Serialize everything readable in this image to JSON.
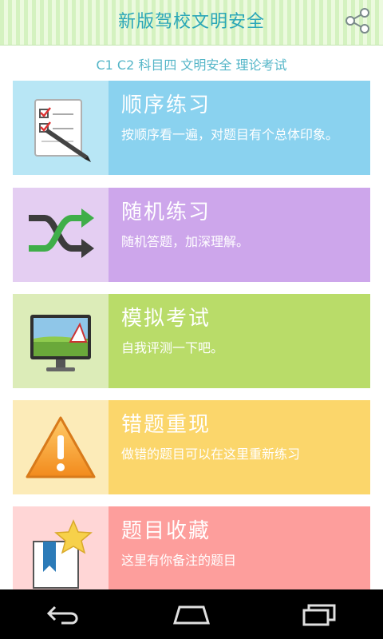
{
  "app_title": "新版驾校文明安全",
  "subtitle": "C1 C2 科目四 文明安全 理论考试",
  "menu": [
    {
      "title": "顺序练习",
      "desc": "按顺序看一遍，对题目有个总体印象。",
      "icon": "notepad-pen-icon"
    },
    {
      "title": "随机练习",
      "desc": "随机答题，加深理解。",
      "icon": "shuffle-icon"
    },
    {
      "title": "模拟考试",
      "desc": "自我评测一下吧。",
      "icon": "monitor-icon"
    },
    {
      "title": "错题重现",
      "desc": "做错的题目可以在这里重新练习",
      "icon": "warning-icon"
    },
    {
      "title": "题目收藏",
      "desc": "这里有你备注的题目",
      "icon": "bookmark-star-icon"
    }
  ],
  "colors": {
    "title": "#2aa6b8",
    "card1": "#8ad2ef",
    "card2": "#cda6eb",
    "card3": "#b9dc69",
    "card4": "#fbd66b",
    "card5": "#fd9e9c"
  },
  "icons": {
    "share": "share-icon",
    "back": "back-icon",
    "home": "home-icon",
    "recents": "recents-icon"
  }
}
